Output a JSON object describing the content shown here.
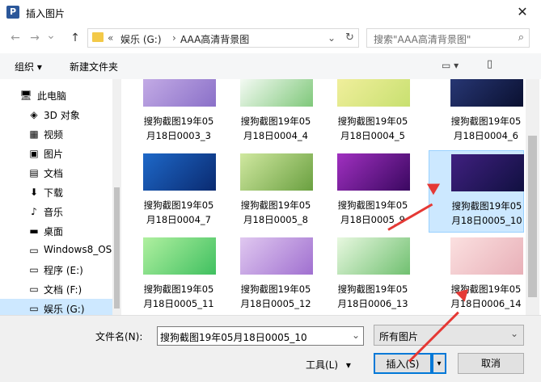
{
  "window": {
    "title": "插入图片",
    "app_icon_letter": "P",
    "close": "✕"
  },
  "nav": {
    "back": "←",
    "forward": "→",
    "recent": "⌄",
    "up": "↑",
    "breadcrumb_overflow": "«",
    "breadcrumb": [
      "娱乐 (G:)",
      "AAA高清背景图"
    ],
    "breadcrumb_sep": "›",
    "dropdown": "⌄",
    "refresh": "↻"
  },
  "search": {
    "placeholder": "搜索\"AAA高清背景图\"",
    "icon": "⌕"
  },
  "toolbar": {
    "organize": "组织 ▾",
    "new_folder": "新建文件夹",
    "view_icon": "▭ ▾",
    "pane_icon": "▯",
    "help_icon": "?"
  },
  "sidebar": {
    "items": [
      {
        "label": "此电脑",
        "icon": "🖥"
      },
      {
        "label": "3D 对象",
        "icon": "◈"
      },
      {
        "label": "视频",
        "icon": "▦"
      },
      {
        "label": "图片",
        "icon": "▣"
      },
      {
        "label": "文档",
        "icon": "▤"
      },
      {
        "label": "下载",
        "icon": "⬇"
      },
      {
        "label": "音乐",
        "icon": "♪"
      },
      {
        "label": "桌面",
        "icon": "▬"
      },
      {
        "label": "Windows8_OS",
        "icon": "▭"
      },
      {
        "label": "程序 (E:)",
        "icon": "▭"
      },
      {
        "label": "文档 (F:)",
        "icon": "▭"
      },
      {
        "label": "娱乐 (G:)",
        "icon": "▭"
      }
    ]
  },
  "files": [
    {
      "line1": "搜狗截图19年05",
      "line2": "月18日0003_3",
      "colors": [
        "#c8b0e8",
        "#8a70c8"
      ]
    },
    {
      "line1": "搜狗截图19年05",
      "line2": "月18日0004_4",
      "colors": [
        "#ffffff",
        "#7fc87a"
      ]
    },
    {
      "line1": "搜狗截图19年05",
      "line2": "月18日0004_5",
      "colors": [
        "#f4f0a0",
        "#c8e070"
      ]
    },
    {
      "line1": "搜狗截图19年05",
      "line2": "月18日0004_6",
      "colors": [
        "#2a3a7a",
        "#0a1030"
      ]
    },
    {
      "line1": "搜狗截图19年05",
      "line2": "月18日0004_7",
      "colors": [
        "#1e68c8",
        "#0a2a70"
      ]
    },
    {
      "line1": "搜狗截图19年05",
      "line2": "月18日0005_8",
      "colors": [
        "#d0e8a0",
        "#6aa040"
      ]
    },
    {
      "line1": "搜狗截图19年05",
      "line2": "月18日0005_9",
      "colors": [
        "#a030c0",
        "#3a0860"
      ]
    },
    {
      "line1": "搜狗截图19年05",
      "line2": "月18日0005_10",
      "colors": [
        "#402080",
        "#101040"
      ]
    },
    {
      "line1": "搜狗截图19年05",
      "line2": "月18日0005_11",
      "colors": [
        "#b0f0a0",
        "#40c060"
      ]
    },
    {
      "line1": "搜狗截图19年05",
      "line2": "月18日0005_12",
      "colors": [
        "#e0c8f0",
        "#a070d0"
      ]
    },
    {
      "line1": "搜狗截图19年05",
      "line2": "月18日0006_13",
      "colors": [
        "#e8f8e0",
        "#70c070"
      ]
    },
    {
      "line1": "搜狗截图19年05",
      "line2": "月18日0006_14",
      "colors": [
        "#fbe0e0",
        "#e8b0b8"
      ]
    }
  ],
  "footer": {
    "filename_label": "文件名(N):",
    "filename_value": "搜狗截图19年05月18日0005_10",
    "filter_value": "所有图片",
    "tools_label": "工具(L)",
    "insert_label": "插入(S)",
    "cancel_label": "取消",
    "caret": "▾"
  },
  "colors": {
    "accent": "#0078d7",
    "selection": "#cce8ff",
    "annotation_arrow": "#e53935"
  }
}
